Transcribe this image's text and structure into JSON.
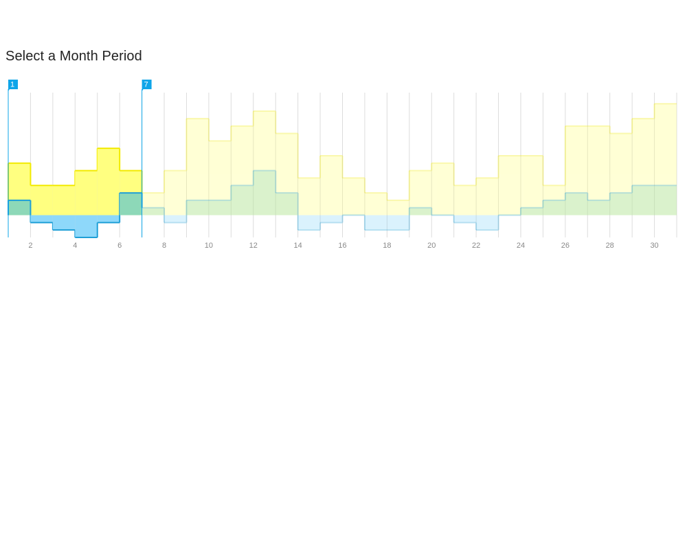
{
  "title": "Select a Month Period",
  "colors": {
    "series_a_fill": "#ffff80",
    "series_a_stroke": "#f2ea00",
    "series_b_fill": "#8ed8fa",
    "series_b_stroke": "#1f9fd6",
    "overlap_fill": "#8dd8b8",
    "grid": "#dcdcdc",
    "handle": "#0ea5e9",
    "axis_text": "#888888"
  },
  "selection": {
    "start_label": "1",
    "end_label": "7",
    "start_day": 1,
    "end_day": 7
  },
  "chart_data": {
    "type": "area",
    "step": true,
    "x": [
      1,
      2,
      3,
      4,
      5,
      6,
      7,
      8,
      9,
      10,
      11,
      12,
      13,
      14,
      15,
      16,
      17,
      18,
      19,
      20,
      21,
      22,
      23,
      24,
      25,
      26,
      27,
      28,
      29,
      30
    ],
    "x_ticks": [
      2,
      4,
      6,
      8,
      10,
      12,
      14,
      16,
      18,
      20,
      22,
      24,
      26,
      28,
      30
    ],
    "xlim": [
      1,
      31
    ],
    "ylim": [
      -3,
      16.5
    ],
    "grid": true,
    "legend": "none",
    "series": [
      {
        "values": [
          7,
          4,
          4,
          6,
          9,
          6,
          3,
          6,
          13,
          10,
          12,
          14,
          11,
          5,
          8,
          5,
          3,
          2,
          6,
          7,
          4,
          5,
          8,
          8,
          4,
          12,
          12,
          11,
          13,
          15
        ]
      },
      {
        "values": [
          2,
          -1,
          -2,
          -3,
          -1,
          3,
          1,
          -1,
          2,
          2,
          4,
          6,
          3,
          -2,
          -1,
          0,
          -2,
          -2,
          1,
          0,
          -1,
          -2,
          0,
          1,
          2,
          3,
          2,
          3,
          4,
          4
        ]
      }
    ]
  }
}
